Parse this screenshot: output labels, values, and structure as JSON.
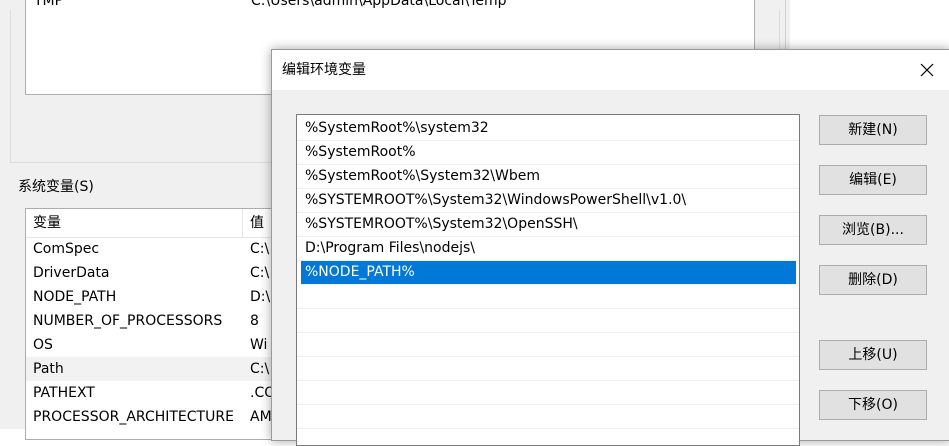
{
  "background": {
    "user_vars": [
      {
        "name": "TMP",
        "value": "C:\\Users\\admin\\AppData\\Local\\Temp"
      }
    ],
    "system_section_label": "系统变量(S)",
    "system_table": {
      "col_name": "变量",
      "col_value": "值",
      "rows": [
        {
          "name": "ComSpec",
          "value": "C:\\"
        },
        {
          "name": "DriverData",
          "value": "C:\\"
        },
        {
          "name": "NODE_PATH",
          "value": "D:\\"
        },
        {
          "name": "NUMBER_OF_PROCESSORS",
          "value": "8"
        },
        {
          "name": "OS",
          "value": "Wi"
        },
        {
          "name": "Path",
          "value": "C:\\"
        },
        {
          "name": "PATHEXT",
          "value": ".CO"
        },
        {
          "name": "PROCESSOR_ARCHITECTURE",
          "value": "AM"
        }
      ]
    }
  },
  "dialog": {
    "title": "编辑环境变量",
    "entries": [
      "%SystemRoot%\\system32",
      "%SystemRoot%",
      "%SystemRoot%\\System32\\Wbem",
      "%SYSTEMROOT%\\System32\\WindowsPowerShell\\v1.0\\",
      "%SYSTEMROOT%\\System32\\OpenSSH\\",
      "D:\\Program Files\\nodejs\\",
      "%NODE_PATH%"
    ],
    "selected_index": 6,
    "buttons": {
      "new": "新建(N)",
      "edit": "编辑(E)",
      "browse": "浏览(B)...",
      "delete": "删除(D)",
      "move_up": "上移(U)",
      "move_down": "下移(O)"
    }
  }
}
